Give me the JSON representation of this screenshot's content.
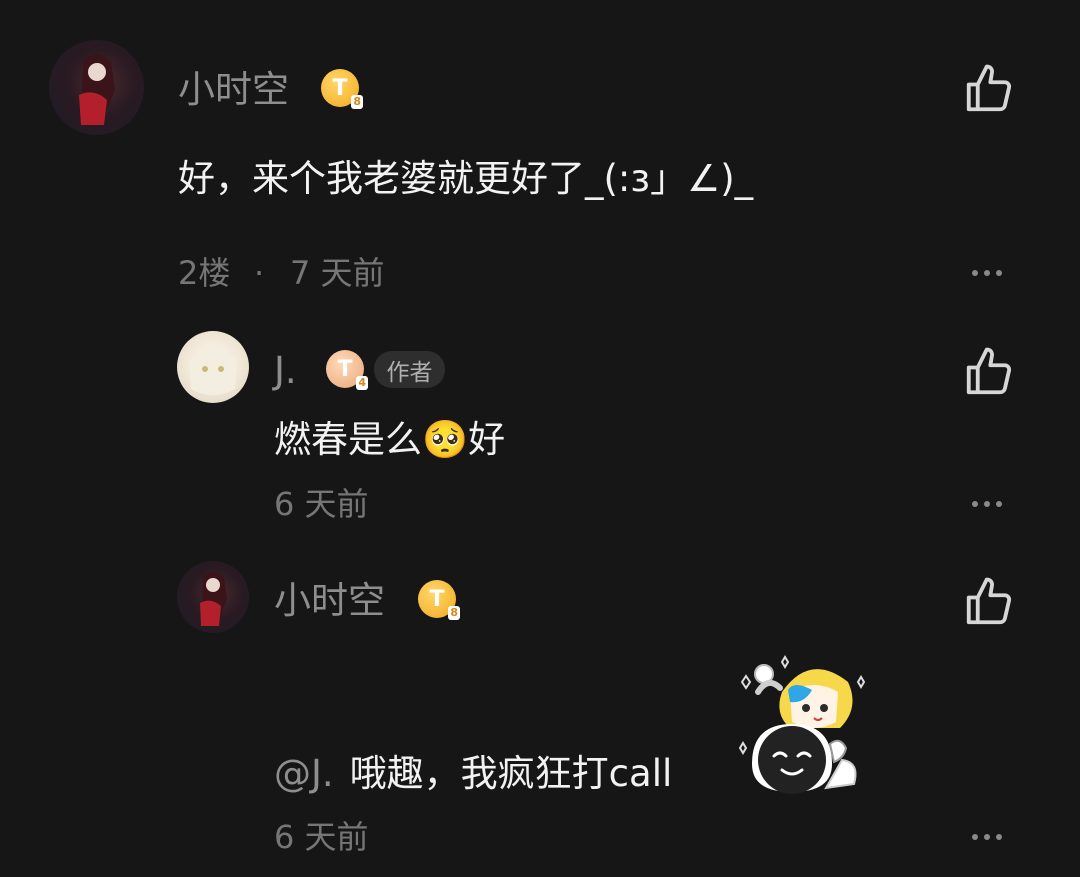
{
  "comments": [
    {
      "username": "小时空",
      "badge": "T",
      "badge_level": "8",
      "content": "好，来个我老婆就更好了_(:з」∠)_",
      "floor": "2楼",
      "separator": "·",
      "time": "7 天前",
      "like_icon": "thumbs-up-icon",
      "more_icon": "more-icon"
    }
  ],
  "replies": [
    {
      "username": "J.",
      "badge": "T",
      "badge_level": "4",
      "author_tag": "作者",
      "content_text": "燃春是么",
      "content_emoji": "🥺",
      "content_after": "好",
      "time": "6 天前"
    },
    {
      "username": "小时空",
      "badge": "T",
      "badge_level": "8",
      "mention": "@J.",
      "content": "哦趣，我疯狂打call",
      "time": "6 天前"
    }
  ],
  "colors": {
    "background": "#161616",
    "username": "#8e8e8e",
    "content": "#f2f2f2",
    "meta": "#767676",
    "badge_gold": "#f3a91e"
  }
}
